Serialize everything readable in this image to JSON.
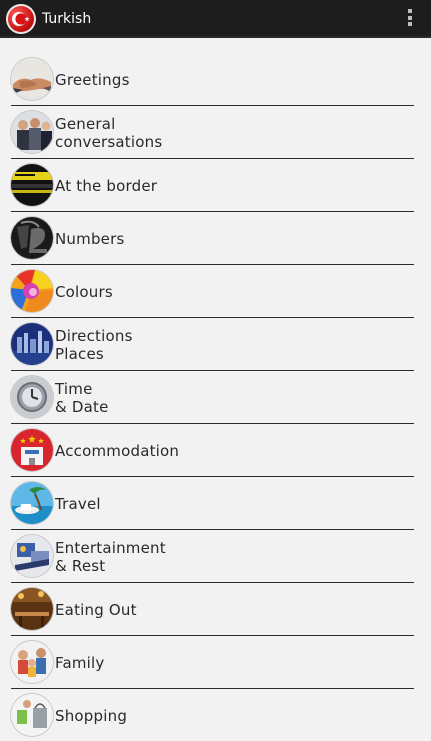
{
  "app": {
    "title": "Turkish",
    "icon": "turkish-flag-icon",
    "overflow_icon": "overflow-menu-icon"
  },
  "categories": [
    {
      "line1": "Greetings",
      "line2": "",
      "icon": "handshake-icon"
    },
    {
      "line1": "General",
      "line2": "conversations",
      "icon": "people-talking-icon"
    },
    {
      "line1": "At the border",
      "line2": "",
      "icon": "passport-control-icon"
    },
    {
      "line1": "Numbers",
      "line2": "",
      "icon": "numbers-icon"
    },
    {
      "line1": "Colours",
      "line2": "",
      "icon": "colour-swirl-icon"
    },
    {
      "line1": "Directions",
      "line2": "Places",
      "icon": "city-skyline-icon"
    },
    {
      "line1": "Time",
      "line2": "& Date",
      "icon": "clock-icon"
    },
    {
      "line1": "Accommodation",
      "line2": "",
      "icon": "hotel-icon"
    },
    {
      "line1": "Travel",
      "line2": "",
      "icon": "beach-icon"
    },
    {
      "line1": "Entertainment",
      "line2": "& Rest",
      "icon": "entertainment-icon"
    },
    {
      "line1": "Eating Out",
      "line2": "",
      "icon": "restaurant-icon"
    },
    {
      "line1": "Family",
      "line2": "",
      "icon": "family-icon"
    },
    {
      "line1": "Shopping",
      "line2": "",
      "icon": "shopping-bags-icon"
    }
  ],
  "colors": {
    "action_bar": "#1d1d1d",
    "background": "#f2f2f2",
    "divider": "#2b2b2b",
    "text": "#2a2a2a"
  }
}
